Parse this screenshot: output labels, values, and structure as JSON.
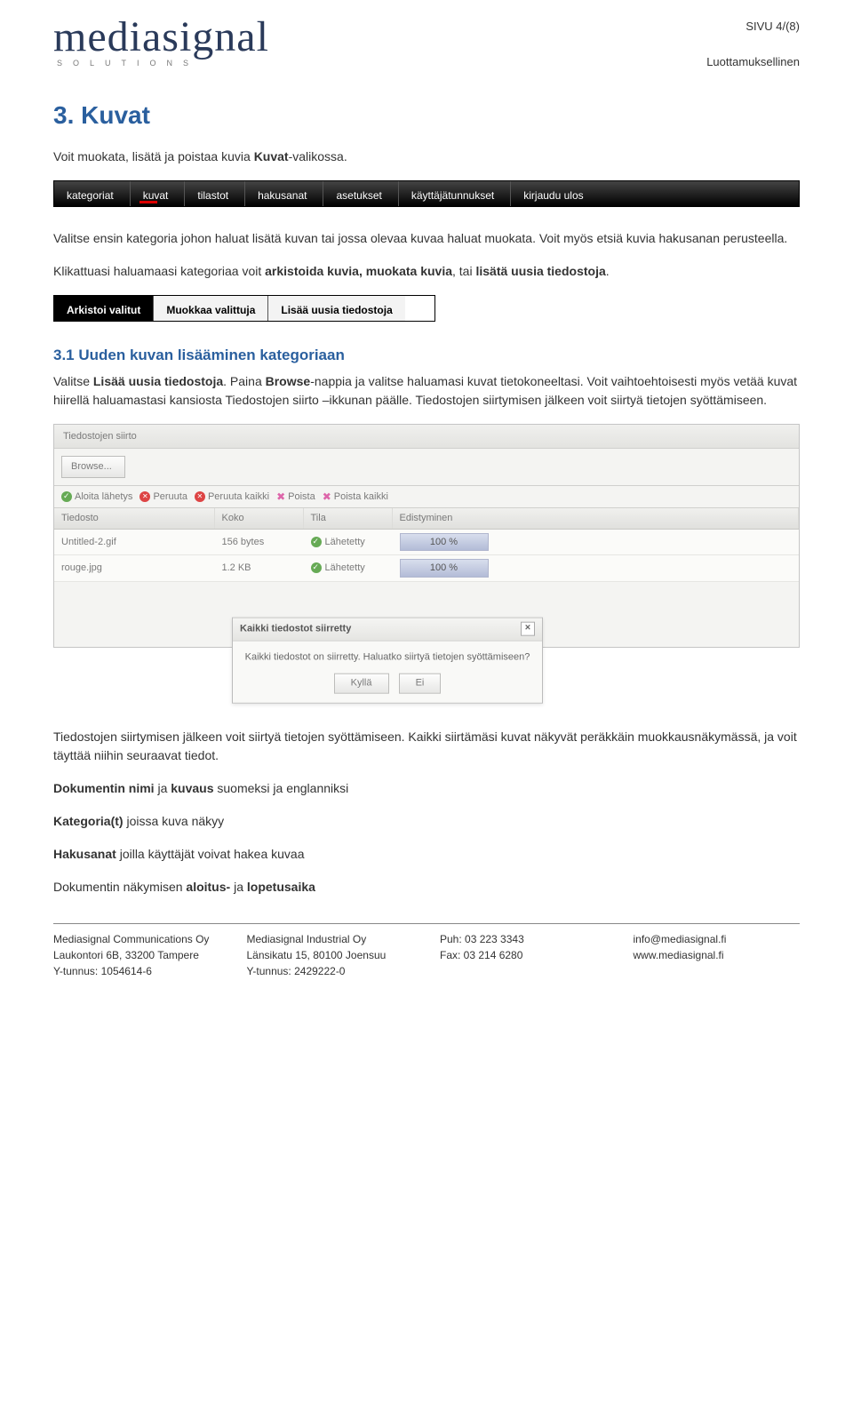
{
  "header": {
    "logo_text": "mediasignal",
    "logo_sub": "SOLUTIONS",
    "page_number": "SIVU 4/(8)",
    "confidential": "Luottamuksellinen"
  },
  "h1": "3. Kuvat",
  "p1_pre": "Voit muokata, lisätä ja poistaa kuvia ",
  "p1_bold": "Kuvat",
  "p1_post": "-valikossa.",
  "nav": [
    "kategoriat",
    "kuvat",
    "tilastot",
    "hakusanat",
    "asetukset",
    "käyttäjätunnukset",
    "kirjaudu ulos"
  ],
  "nav_active_index": 1,
  "p2": "Valitse ensin kategoria johon haluat lisätä kuvan tai jossa olevaa kuvaa haluat muokata. Voit myös etsiä kuvia hakusanan perusteella.",
  "p3_pre": "Klikattuasi haluamaasi kategoriaa voit ",
  "p3_b1": "arkistoida kuvia, muokata kuvia",
  "p3_mid": ", tai ",
  "p3_b2": "lisätä uusia tiedostoja",
  "p3_post": ".",
  "actions": [
    "Arkistoi valitut",
    "Muokkaa valittuja",
    "Lisää uusia tiedostoja"
  ],
  "h2": "3.1 Uuden kuvan lisääminen kategoriaan",
  "p4_pre": "Valitse ",
  "p4_b1": "Lisää uusia tiedostoja",
  "p4_mid": ". Paina ",
  "p4_b2": "Browse",
  "p4_post": "-nappia ja valitse haluamasi kuvat tietokoneeltasi. Voit vaihtoehtoisesti myös vetää kuvat hiirellä haluamastasi kansiosta Tiedostojen siirto –ikkunan päälle. Tiedostojen siirtymisen jälkeen voit siirtyä tietojen syöttämiseen.",
  "upload": {
    "title": "Tiedostojen siirto",
    "browse": "Browse...",
    "tools": {
      "start": "Aloita lähetys",
      "cancel": "Peruuta",
      "cancel_all": "Peruuta kaikki",
      "remove": "Poista",
      "remove_all": "Poista kaikki"
    },
    "cols": [
      "Tiedosto",
      "Koko",
      "Tila",
      "Edistyminen"
    ],
    "rows": [
      {
        "file": "Untitled-2.gif",
        "size": "156 bytes",
        "status": "Lähetetty",
        "progress": "100 %"
      },
      {
        "file": "rouge.jpg",
        "size": "1.2 KB",
        "status": "Lähetetty",
        "progress": "100 %"
      }
    ]
  },
  "dialog": {
    "title": "Kaikki tiedostot siirretty",
    "body": "Kaikki tiedostot on siirretty. Haluatko siirtyä tietojen syöttämiseen?",
    "yes": "Kyllä",
    "no": "Ei"
  },
  "p5": "Tiedostojen siirtymisen jälkeen voit siirtyä tietojen syöttämiseen. Kaikki siirtämäsi kuvat näkyvät peräkkäin muokkausnäkymässä, ja voit täyttää niihin seuraavat tiedot.",
  "p6_b": "Dokumentin nimi",
  "p6_mid": " ja ",
  "p6_b2": "kuvaus",
  "p6_post": " suomeksi ja englanniksi",
  "p7_b": "Kategoria(t)",
  "p7_post": " joissa kuva näkyy",
  "p8_b": "Hakusanat",
  "p8_post": " joilla käyttäjät voivat hakea kuvaa",
  "p9_pre": "Dokumentin näkymisen ",
  "p9_b1": "aloitus-",
  "p9_mid": " ja ",
  "p9_b2": "lopetusaika",
  "footer": {
    "c1a": "Mediasignal Communications Oy",
    "c1b": "Laukontori 6B, 33200 Tampere",
    "c1c": "Y-tunnus: 1054614-6",
    "c2a": "Mediasignal Industrial Oy",
    "c2b": "Länsikatu 15, 80100 Joensuu",
    "c2c": "Y-tunnus: 2429222-0",
    "c3a": "Puh: 03 223 3343",
    "c3b": "Fax: 03 214 6280",
    "c4a": "info@mediasignal.fi",
    "c4b": "www.mediasignal.fi"
  }
}
